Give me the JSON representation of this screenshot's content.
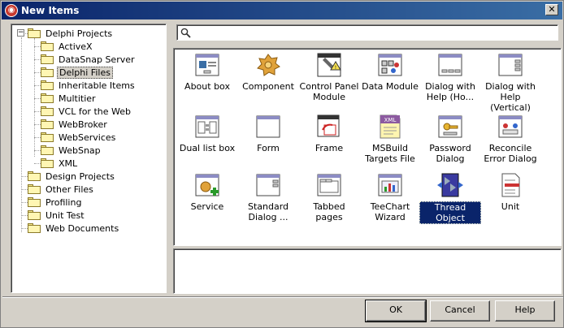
{
  "window": {
    "title": "New Items",
    "close_glyph": "✕"
  },
  "tree": {
    "nodes": [
      {
        "label": "Delphi Projects",
        "level": 0,
        "expander": "−"
      },
      {
        "label": "ActiveX",
        "level": 1
      },
      {
        "label": "DataSnap Server",
        "level": 1
      },
      {
        "label": "Delphi Files",
        "level": 1,
        "selected": true
      },
      {
        "label": "Inheritable Items",
        "level": 1
      },
      {
        "label": "Multitier",
        "level": 1
      },
      {
        "label": "VCL for the Web",
        "level": 1
      },
      {
        "label": "WebBroker",
        "level": 1
      },
      {
        "label": "WebServices",
        "level": 1
      },
      {
        "label": "WebSnap",
        "level": 1
      },
      {
        "label": "XML",
        "level": 1
      },
      {
        "label": "Design Projects",
        "level": 0
      },
      {
        "label": "Other Files",
        "level": 0
      },
      {
        "label": "Profiling",
        "level": 0
      },
      {
        "label": "Unit Test",
        "level": 0
      },
      {
        "label": "Web Documents",
        "level": 0
      }
    ]
  },
  "search": {
    "value": "",
    "placeholder": ""
  },
  "items": [
    {
      "label": "About box",
      "icon": "about-box-icon"
    },
    {
      "label": "Component",
      "icon": "component-icon"
    },
    {
      "label": "Control Panel Module",
      "icon": "control-panel-module-icon"
    },
    {
      "label": "Data Module",
      "icon": "data-module-icon"
    },
    {
      "label": "Dialog with Help (Ho...",
      "icon": "dialog-with-help-icon"
    },
    {
      "label": "Dialog with Help (Vertical)",
      "icon": "dialog-with-help-vertical-icon"
    },
    {
      "label": "Dual list box",
      "icon": "dual-list-box-icon"
    },
    {
      "label": "Form",
      "icon": "form-icon"
    },
    {
      "label": "Frame",
      "icon": "frame-icon"
    },
    {
      "label": "MSBuild Targets File",
      "icon": "msbuild-targets-file-icon",
      "badge": "XML"
    },
    {
      "label": "Password Dialog",
      "icon": "password-dialog-icon"
    },
    {
      "label": "Reconcile Error Dialog",
      "icon": "reconcile-error-dialog-icon"
    },
    {
      "label": "Service",
      "icon": "service-icon"
    },
    {
      "label": "Standard Dialog ...",
      "icon": "standard-dialog-icon"
    },
    {
      "label": "Tabbed pages",
      "icon": "tabbed-pages-icon"
    },
    {
      "label": "TeeChart Wizard",
      "icon": "teechart-wizard-icon"
    },
    {
      "label": "Thread Object",
      "icon": "thread-object-icon",
      "selected": true
    },
    {
      "label": "Unit",
      "icon": "unit-icon"
    }
  ],
  "buttons": {
    "ok": "OK",
    "cancel": "Cancel",
    "help": "Help"
  }
}
